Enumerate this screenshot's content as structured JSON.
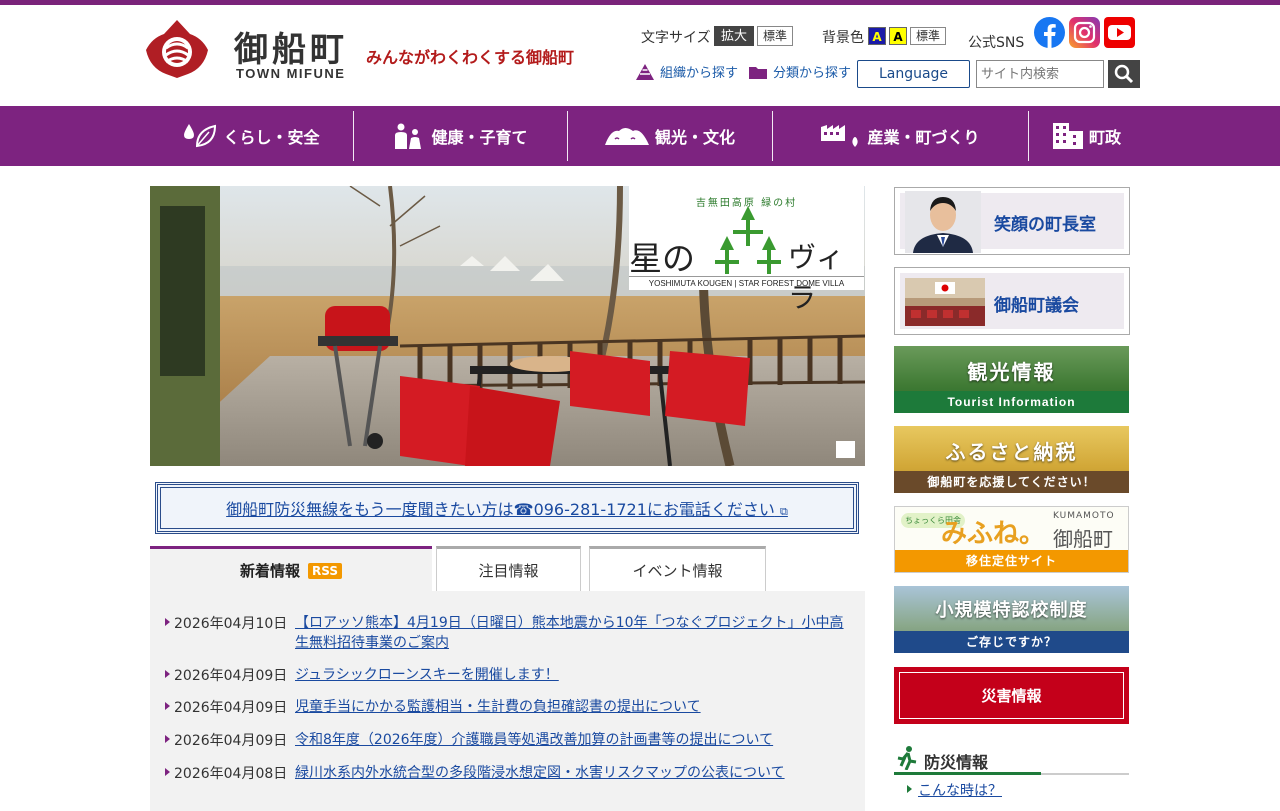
{
  "header": {
    "logo_jp": "御船町",
    "logo_en": "TOWN MIFUNE",
    "tagline": "みんながわくわくする御船町",
    "font_size_label": "文字サイズ",
    "font_enlarge": "拡大",
    "font_standard": "標準",
    "bg_color_label": "背景色",
    "bg_blue": "A",
    "bg_yellow": "A",
    "bg_standard": "標準",
    "sns_label": "公式SNS",
    "search_by_org": "組織から探す",
    "search_by_category": "分類から探す",
    "language": "Language",
    "search_placeholder": "サイト内検索"
  },
  "nav": [
    {
      "label": "くらし・安全",
      "icon": "drop-leaf-icon"
    },
    {
      "label": "健康・子育て",
      "icon": "family-icon"
    },
    {
      "label": "観光・文化",
      "icon": "mountain-icon"
    },
    {
      "label": "産業・町づくり",
      "icon": "factory-icon"
    },
    {
      "label": "町政",
      "icon": "building-icon"
    }
  ],
  "hero": {
    "badge_top": "吉無田高原 緑の村",
    "badge_title_a": "星の",
    "badge_title_b": "ヴィラ",
    "badge_sub": "YOSHIMUTA KOUGEN | STAR FOREST DOME VILLA"
  },
  "notice": {
    "text": "御船町防災無線をもう一度聞きたい方は☎096-281-1721にお電話ください"
  },
  "tabs": {
    "new": "新着情報",
    "rss": "RSS",
    "featured": "注目情報",
    "event": "イベント情報"
  },
  "news": [
    {
      "date": "2026年04月10日",
      "title": "【ロアッソ熊本】4月19日（日曜日）熊本地震から10年「つなぐプロジェクト」小中高生無料招待事業のご案内"
    },
    {
      "date": "2026年04月09日",
      "title": "ジュラシックローンスキーを開催します！"
    },
    {
      "date": "2026年04月09日",
      "title": "児童手当にかかる監護相当・生計費の負担確認書の提出について"
    },
    {
      "date": "2026年04月09日",
      "title": "令和8年度（2026年度）介護職員等処遇改善加算の計画書等の提出について"
    },
    {
      "date": "2026年04月08日",
      "title": "緑川水系内外水統合型の多段階浸水想定図・水害リスクマップの公表について"
    }
  ],
  "sidebar": {
    "mayor": "笑顔の町長室",
    "assembly": "御船町議会",
    "tourist_big": "観光情報",
    "tourist_small": "Tourist Information",
    "furusato_big": "ふるさと納税",
    "furusato_small": "御船町を応援してください！",
    "iju_logo": "みふね。",
    "iju_sub": "ちょっくら田舎",
    "iju_kumamoto": "KUMAMOTO",
    "iju_town": "御船町",
    "iju_small": "移住定住サイト",
    "school_big": "小規模特認校制度",
    "school_small": "ご存じですか？",
    "disaster": "災害情報",
    "bousai_title": "防災情報",
    "bousai_link": "こんな時は？"
  }
}
